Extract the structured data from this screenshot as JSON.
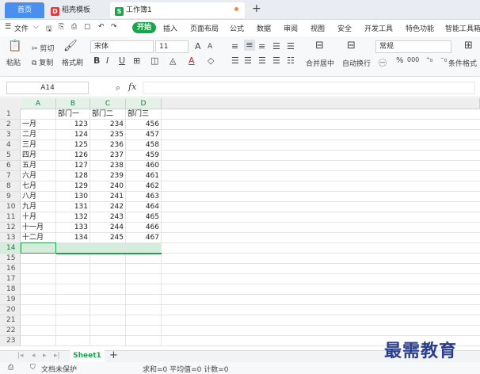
{
  "tabs": {
    "home": "首页",
    "template": "稻壳模板",
    "workbook": "工作簿1",
    "new_tab": "+"
  },
  "menu": {
    "file": "文件",
    "start": "开始",
    "items": [
      "插入",
      "页面布局",
      "公式",
      "数据",
      "审阅",
      "视图",
      "安全",
      "开发工具",
      "特色功能",
      "智能工具箱"
    ]
  },
  "ribbon": {
    "paste": "粘贴",
    "cut": "剪切",
    "copy": "复制",
    "format_painter": "格式刷",
    "font_name": "宋体",
    "font_size": "11",
    "bold": "B",
    "italic": "I",
    "underline": "U",
    "font_color": "A",
    "increase_font": "A",
    "decrease_font": "A",
    "merge_center": "合并居中",
    "wrap_text": "自动换行",
    "number_format": "常规",
    "percent": "%",
    "thousand_sep": "000",
    "conditional_format": "条件格式"
  },
  "formula_bar": {
    "cell_ref": "A14",
    "fx": "fx",
    "value": ""
  },
  "grid": {
    "columns": [
      "A",
      "B",
      "C",
      "D"
    ],
    "row_numbers": [
      "1",
      "2",
      "3",
      "4",
      "5",
      "6",
      "7",
      "8",
      "9",
      "10",
      "11",
      "12",
      "13",
      "14",
      "15",
      "16",
      "17",
      "18",
      "19",
      "20",
      "21",
      "22",
      "23"
    ],
    "header_row": [
      "",
      "部门一",
      "部门二",
      "部门三"
    ],
    "rows": [
      [
        "一月",
        "123",
        "234",
        "456"
      ],
      [
        "二月",
        "124",
        "235",
        "457"
      ],
      [
        "三月",
        "125",
        "236",
        "458"
      ],
      [
        "四月",
        "126",
        "237",
        "459"
      ],
      [
        "五月",
        "127",
        "238",
        "460"
      ],
      [
        "六月",
        "128",
        "239",
        "461"
      ],
      [
        "七月",
        "129",
        "240",
        "462"
      ],
      [
        "八月",
        "130",
        "241",
        "463"
      ],
      [
        "九月",
        "131",
        "242",
        "464"
      ],
      [
        "十月",
        "132",
        "243",
        "465"
      ],
      [
        "十一月",
        "133",
        "244",
        "466"
      ],
      [
        "十二月",
        "134",
        "245",
        "467"
      ]
    ],
    "selected_row": "14"
  },
  "sheets": {
    "active": "Sheet1",
    "add": "+"
  },
  "status": {
    "protection": "文档未保护",
    "summary": "求和=0  平均值=0  计数=0"
  },
  "watermark": "最需教育",
  "colors": {
    "accent_green": "#1ba54a",
    "home_tab_blue": "#4a8ef0",
    "selection_green": "#2e9d4f"
  }
}
